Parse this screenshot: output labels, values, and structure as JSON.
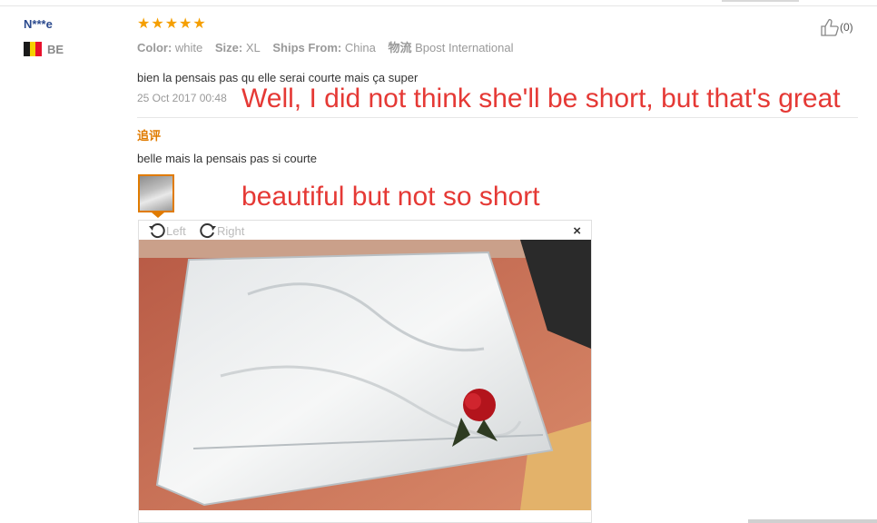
{
  "reviewer": {
    "name": "N***e",
    "country_code": "BE",
    "flag_colors": [
      "#1a1a1a",
      "#f5d000",
      "#e8112d"
    ]
  },
  "rating": {
    "stars": 5,
    "color": "#f59f00"
  },
  "meta": {
    "color_label": "Color:",
    "color_value": "white",
    "size_label": "Size:",
    "size_value": "XL",
    "ships_label": "Ships From:",
    "ships_value": "China",
    "logistics_label": "物流",
    "logistics_value": "Bpost International"
  },
  "like": {
    "count": "(0)"
  },
  "review": {
    "text": "bien la pensais pas qu elle serai courte mais ça super",
    "date": "25 Oct 2017 00:48",
    "translation": "Well, I did not think she'll be short, but that's great"
  },
  "followup": {
    "label": "追评",
    "text": "belle mais la pensais pas si courte",
    "translation": "beautiful but not so short"
  },
  "viewer": {
    "rotate_left": "Left",
    "rotate_right": "Right",
    "close": "×"
  },
  "colors": {
    "accent_orange": "#e07b00",
    "annotation_red": "#e53935",
    "username_blue": "#2b4a8e"
  }
}
